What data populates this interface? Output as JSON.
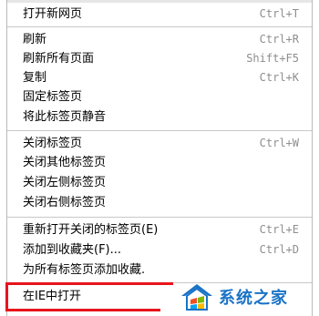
{
  "menu": {
    "groups": [
      [
        {
          "label": "打开新网页",
          "shortcut": "Ctrl+T"
        }
      ],
      [
        {
          "label": "刷新",
          "shortcut": "Ctrl+R"
        },
        {
          "label": "刷新所有页面",
          "shortcut": "Shift+F5"
        },
        {
          "label": "复制",
          "shortcut": "Ctrl+K"
        },
        {
          "label": "固定标签页",
          "shortcut": ""
        },
        {
          "label": "将此标签页静音",
          "shortcut": ""
        }
      ],
      [
        {
          "label": "关闭标签页",
          "shortcut": "Ctrl+W"
        },
        {
          "label": "关闭其他标签页",
          "shortcut": ""
        },
        {
          "label": "关闭左侧标签页",
          "shortcut": ""
        },
        {
          "label": "关闭右侧标签页",
          "shortcut": ""
        }
      ],
      [
        {
          "label": "重新打开关闭的标签页(E)",
          "shortcut": "Ctrl+E"
        },
        {
          "label": "添加到收藏夹(F)...",
          "shortcut": "Ctrl+D"
        },
        {
          "label": "为所有标签页添加收藏.",
          "shortcut": ""
        }
      ],
      [
        {
          "label": "在IE中打开",
          "shortcut": ""
        }
      ]
    ]
  },
  "watermark": {
    "text": "系统之家",
    "color": "#1a73c6"
  },
  "colors": {
    "highlight_border": "#e8141c",
    "shortcut_text": "#8e8e8e",
    "separator": "#c8c8c8"
  }
}
